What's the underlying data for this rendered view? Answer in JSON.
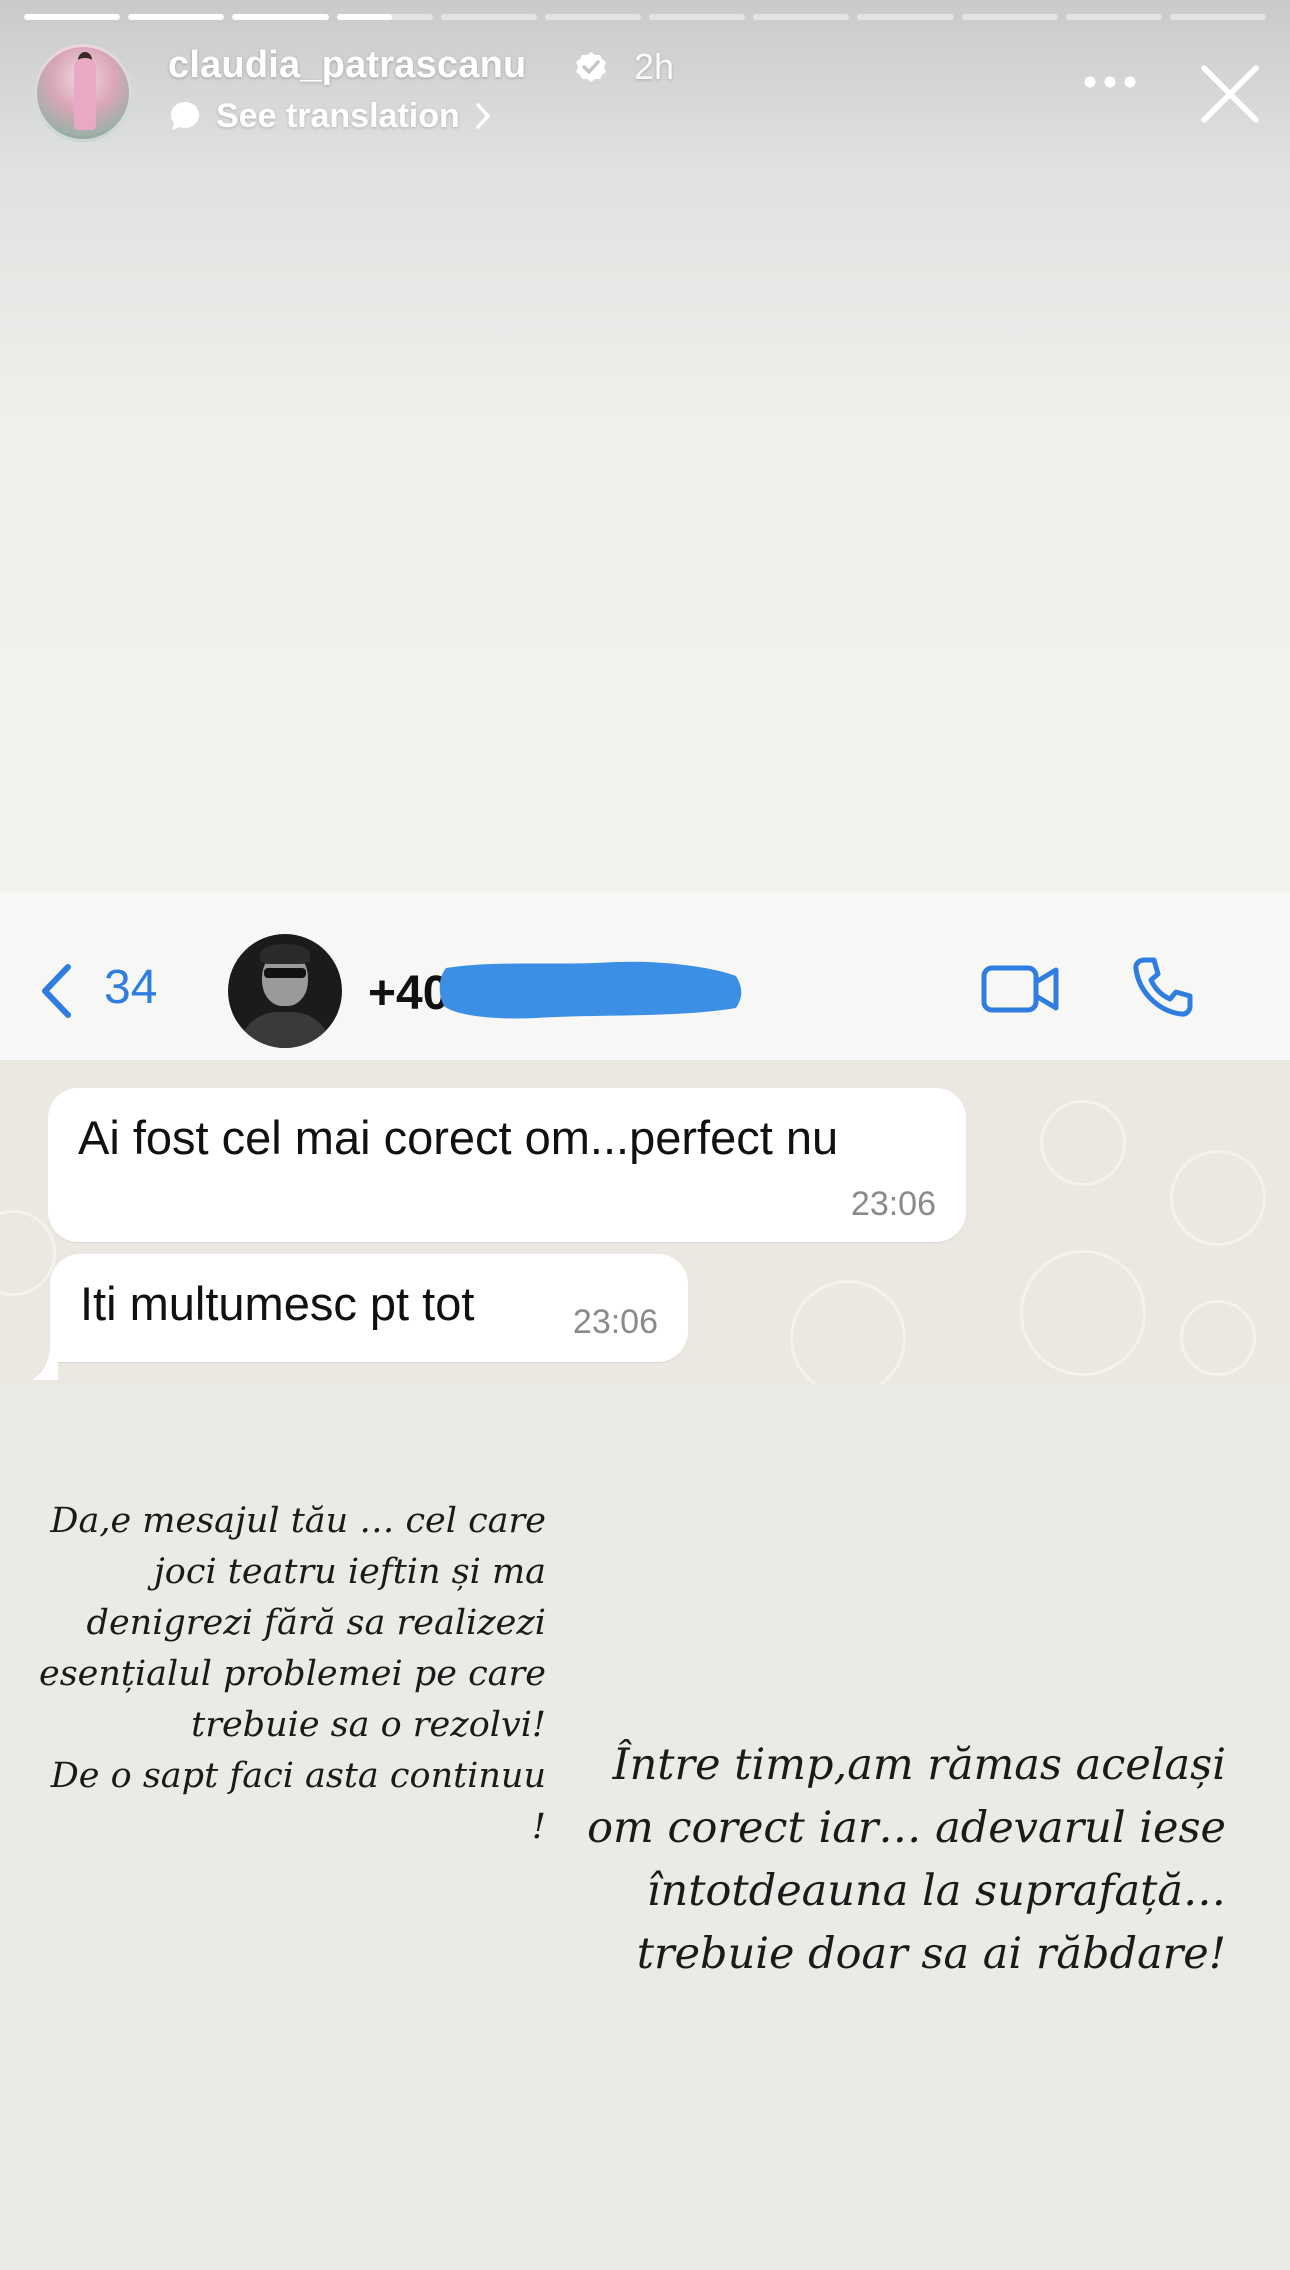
{
  "story": {
    "progress_segments": 12,
    "active_segment_index": 3,
    "active_segment_fraction": 0.58
  },
  "header": {
    "username": "claudia_patrascanu",
    "age": "2h",
    "see_translation": "See translation"
  },
  "whatsapp": {
    "back_count": "34",
    "phone_visible": "+40",
    "accent_color": "#2f7de0",
    "messages": [
      {
        "text": "Ai fost cel mai corect om...perfect nu",
        "time": "23:06"
      },
      {
        "text": "Iti multumesc pt tot",
        "time": "23:06"
      }
    ]
  },
  "captions": {
    "left": "Da,e mesajul tău … cel care\njoci teatru ieftin și ma\ndenigrezi fără sa realizezi\nesențialul problemei pe care\ntrebuie sa o rezolvi!\nDe o sapt faci asta continuu !",
    "right": "Între timp,am rămas același\nom corect iar… adevarul iese\nîntotdeauna la suprafață…\ntrebuie doar sa ai  răbdare!"
  },
  "icons": [
    "verified-badge-icon",
    "translate-bubble-icon",
    "chevron-right-icon",
    "more-options-icon",
    "close-icon",
    "back-chevron-icon",
    "video-call-icon",
    "phone-call-icon"
  ]
}
